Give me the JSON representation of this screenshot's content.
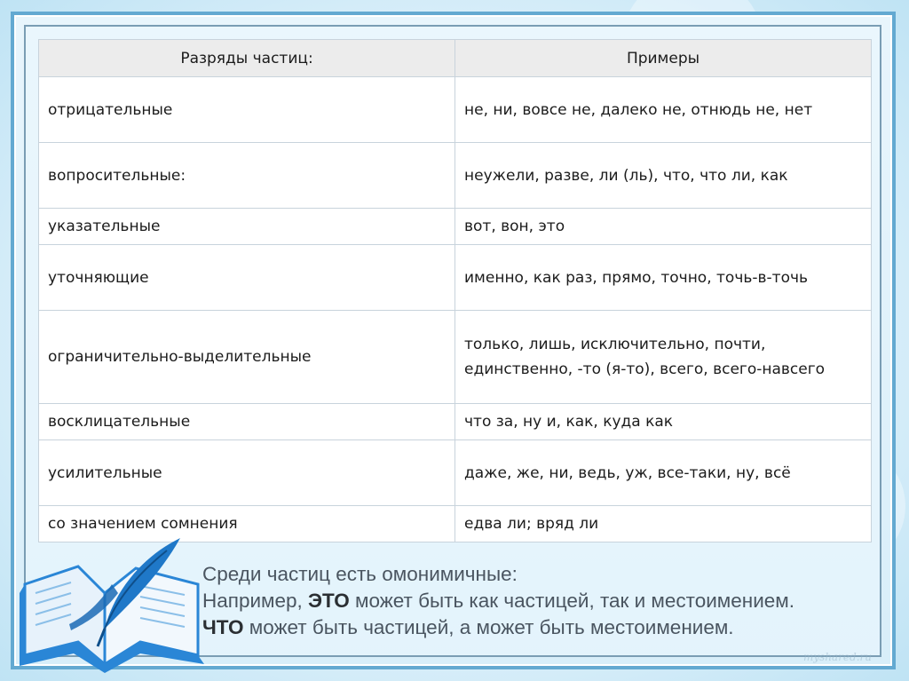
{
  "table": {
    "headers": [
      "Разряды частиц:",
      "Примеры"
    ],
    "rows": [
      {
        "category": "отрицательные",
        "examples": [
          "не, ни, вовсе не, далеко не, отнюдь не, нет"
        ]
      },
      {
        "category": "вопросительные:",
        "examples": [
          "неужели, разве, ли (ль), что, что ли, как"
        ]
      },
      {
        "category": "указательные",
        "examples": [
          "вот, вон, это"
        ]
      },
      {
        "category": "уточняющие",
        "examples": [
          "именно, как раз, прямо, точно, точь-в-точь"
        ]
      },
      {
        "category": "ограничительно-выделительные",
        "examples": [
          "только, лишь, исключительно, почти,",
          "единственно, -то (я-то), всего, всего-навсего"
        ]
      },
      {
        "category": "восклицательные",
        "examples": [
          "что за, ну и, как, куда как"
        ]
      },
      {
        "category": "усилительные",
        "examples": [
          "даже, же, ни, ведь, уж, все-таки, ну, всё"
        ]
      },
      {
        "category": "со значением сомнения",
        "examples": [
          "едва ли; вряд ли"
        ]
      }
    ]
  },
  "note": {
    "line1": "Среди частиц есть омонимичные:",
    "line2_prefix": "Например, ",
    "line2_bold": "ЭТО",
    "line2_suffix": " может быть как частицей, так и местоимением.",
    "line3_bold": "ЧТО",
    "line3_suffix": " может быть частицей, а может быть местоимением."
  },
  "watermark": "myshared.ru",
  "colors": {
    "frame_border": "#63a9d1",
    "header_bg": "#ececec",
    "quill_blue": "#1f78c8",
    "book_blue": "#2a86d6"
  },
  "icons": [
    "quill-pen-icon",
    "open-book-icon"
  ]
}
